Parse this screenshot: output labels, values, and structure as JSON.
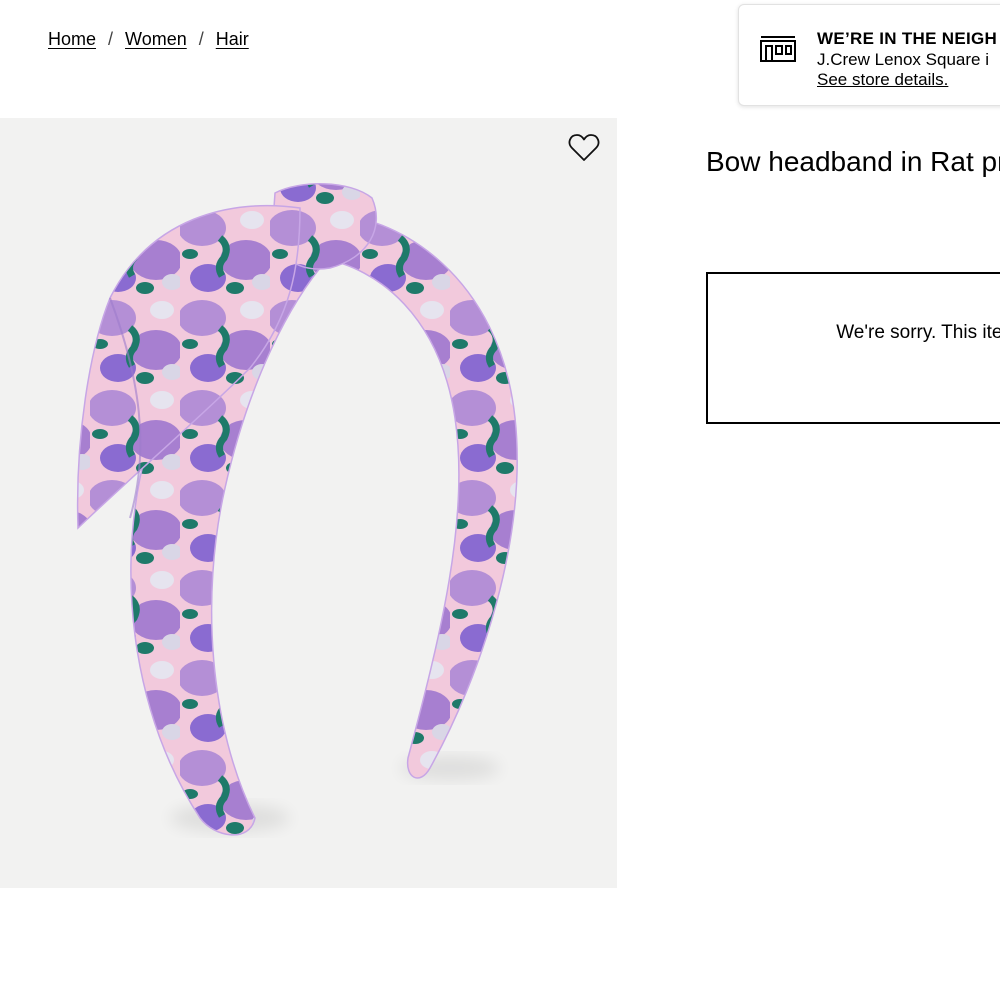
{
  "breadcrumb": {
    "items": [
      {
        "label": "Home"
      },
      {
        "label": "Women"
      },
      {
        "label": "Hair"
      }
    ],
    "separator": "/"
  },
  "store": {
    "icon": "store-icon",
    "title": "WE’RE IN THE NEIGH",
    "line": "J.Crew Lenox Square i",
    "link": "See store details."
  },
  "product": {
    "title": "Bow headband in Rat print",
    "wishlist_icon": "heart-outline-icon",
    "image_alt": "purple floral bow headband"
  },
  "notice": {
    "text": "We're sorry. This item has it has sold c"
  },
  "colors": {
    "image_bg": "#f2f2f1",
    "lilac": "#b48fd6",
    "violet": "#8a6bd1",
    "teal": "#1f7a6a",
    "pink": "#f2c9dc"
  }
}
